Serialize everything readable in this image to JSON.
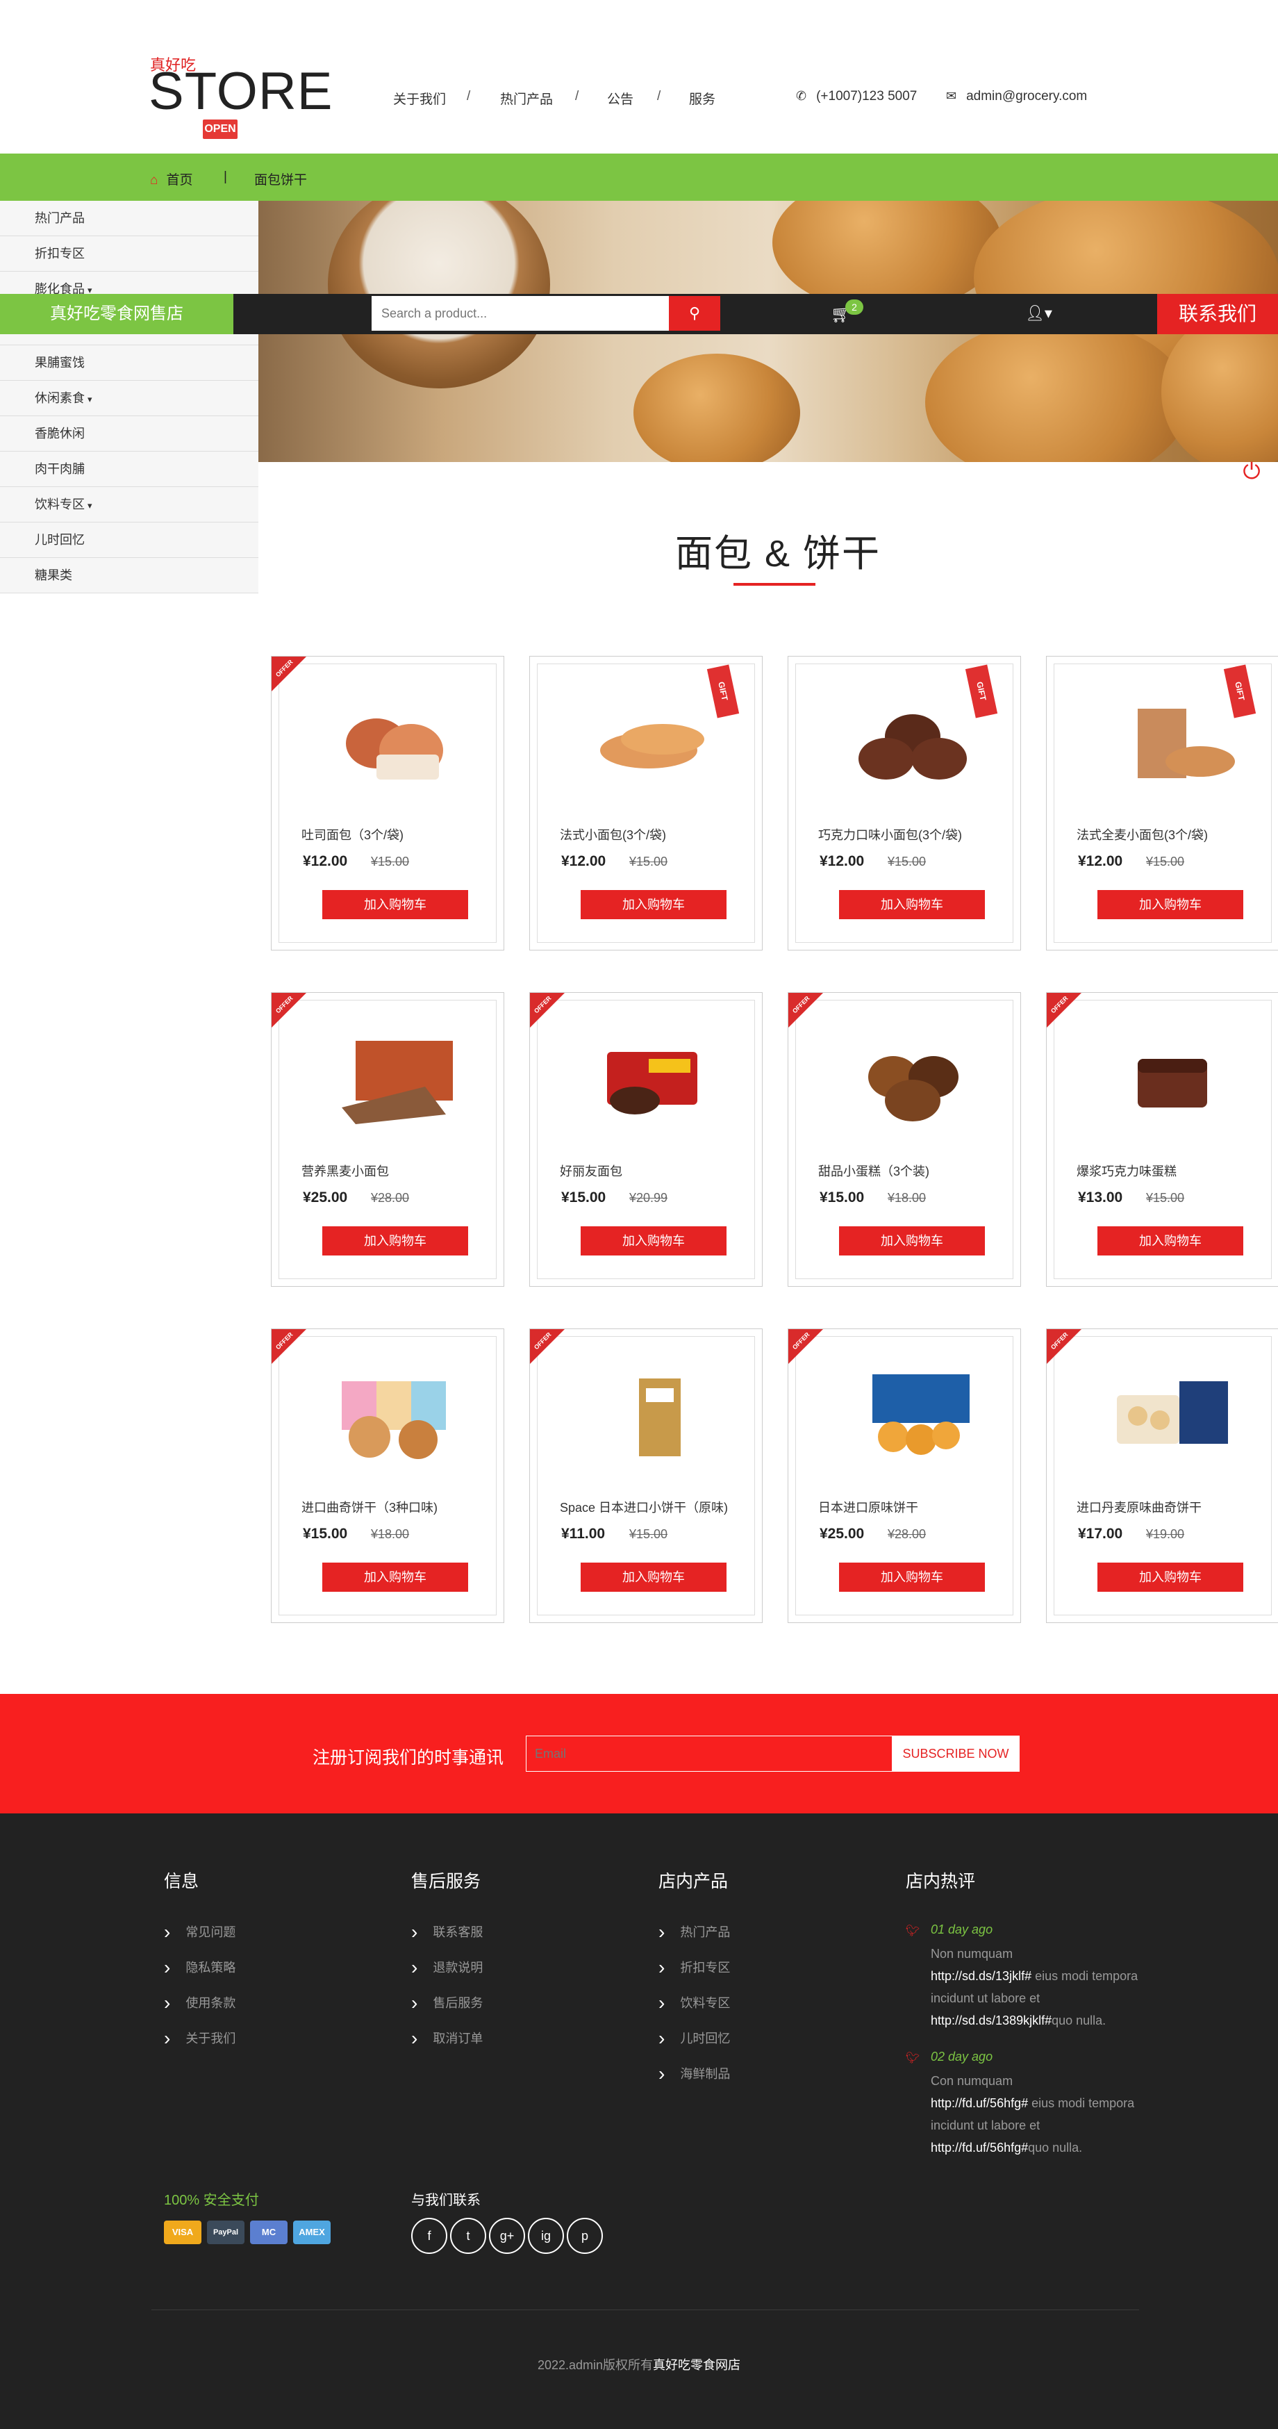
{
  "header": {
    "logo_small": "真好吃",
    "logo_big": "STORE",
    "logo_badge": "OPEN",
    "nav": [
      "关于我们",
      "热门产品",
      "公告",
      "服务"
    ],
    "nav_separator": "/",
    "phone": "(+1007)123 5007",
    "email": "admin@grocery.com"
  },
  "breadcrumb": {
    "home": "首页",
    "separator": "|",
    "current": "面包饼干"
  },
  "sidebar": {
    "items": [
      {
        "label": "热门产品"
      },
      {
        "label": "折扣专区"
      },
      {
        "label": "膨化食品"
      },
      {
        "label": "果脯蜜饯"
      },
      {
        "label": "休闲素食"
      },
      {
        "label": "香脆休闲"
      },
      {
        "label": "肉干肉脯"
      },
      {
        "label": "饮料专区"
      },
      {
        "label": "儿时回忆"
      },
      {
        "label": "糖果类"
      }
    ]
  },
  "searchbar": {
    "brand": "真好吃零食网售店",
    "placeholder": "Search a product...",
    "cart_count": "2",
    "contact_button": "联系我们"
  },
  "section": {
    "title": "面包 & 饼干"
  },
  "products": [
    {
      "name": "吐司面包（3个/袋)",
      "price": "¥12.00",
      "old": "¥15.00",
      "tag": "offer"
    },
    {
      "name": "法式小面包(3个/袋)",
      "price": "¥12.00",
      "old": "¥15.00",
      "tag": "gift"
    },
    {
      "name": "巧克力口味小面包(3个/袋)",
      "price": "¥12.00",
      "old": "¥15.00",
      "tag": "gift"
    },
    {
      "name": "法式全麦小面包(3个/袋)",
      "price": "¥12.00",
      "old": "¥15.00",
      "tag": "gift"
    },
    {
      "name": "营养黑麦小面包",
      "price": "¥25.00",
      "old": "¥28.00",
      "tag": "offer"
    },
    {
      "name": "好丽友面包",
      "price": "¥15.00",
      "old": "¥20.99",
      "tag": "offer"
    },
    {
      "name": "甜品小蛋糕（3个装)",
      "price": "¥15.00",
      "old": "¥18.00",
      "tag": "offer"
    },
    {
      "name": "爆浆巧克力味蛋糕",
      "price": "¥13.00",
      "old": "¥15.00",
      "tag": "offer"
    },
    {
      "name": "进口曲奇饼干（3种口味)",
      "price": "¥15.00",
      "old": "¥18.00",
      "tag": "offer"
    },
    {
      "name": "Space 日本进口小饼干（原味)",
      "price": "¥11.00",
      "old": "¥15.00",
      "tag": "offer"
    },
    {
      "name": "日本进口原味饼干",
      "price": "¥25.00",
      "old": "¥28.00",
      "tag": "offer"
    },
    {
      "name": "进口丹麦原味曲奇饼干",
      "price": "¥17.00",
      "old": "¥19.00",
      "tag": "offer"
    }
  ],
  "product_labels": {
    "add_to_cart": "加入购物车",
    "offer": "OFFER",
    "gift": "GIFT"
  },
  "newsletter": {
    "title": "注册订阅我们的时事通讯",
    "placeholder": "Email",
    "button": "SUBSCRIBE NOW"
  },
  "footer": {
    "col1": {
      "title": "信息",
      "links": [
        "常见问题",
        "隐私策略",
        "使用条款",
        "关于我们"
      ]
    },
    "col2": {
      "title": "售后服务",
      "links": [
        "联系客服",
        "退款说明",
        "售后服务",
        "取消订单"
      ]
    },
    "col3": {
      "title": "店内产品",
      "links": [
        "热门产品",
        "折扣专区",
        "饮料专区",
        "儿时回忆",
        "海鲜制品"
      ]
    },
    "col4": {
      "title": "店内热评",
      "tweets": [
        {
          "date": "01 day ago",
          "l1": "Non numquam",
          "link1": "http://sd.ds/13jklf#",
          "l2": " eius modi tempora incidunt ut labore et ",
          "link2": "http://sd.ds/1389kjklf#",
          "l3": "quo nulla."
        },
        {
          "date": "02 day ago",
          "l1": "Con numquam",
          "link1": "http://fd.uf/56hfg#",
          "l2": " eius modi tempora incidunt ut labore et ",
          "link2": "http://fd.uf/56hfg#",
          "l3": "quo nulla."
        }
      ]
    },
    "secure": "100% 安全支付",
    "payments": [
      "VISA",
      "PayPal",
      "MC",
      "AMEX"
    ],
    "social_title": "与我们联系",
    "social": [
      "f",
      "t",
      "g+",
      "ig",
      "p"
    ],
    "copyright_prefix": "2022.admin版权所有",
    "copyright_name": "真好吃零食网店"
  },
  "colors": {
    "green": "#7cc543",
    "red": "#e52323",
    "dark": "#222222"
  }
}
